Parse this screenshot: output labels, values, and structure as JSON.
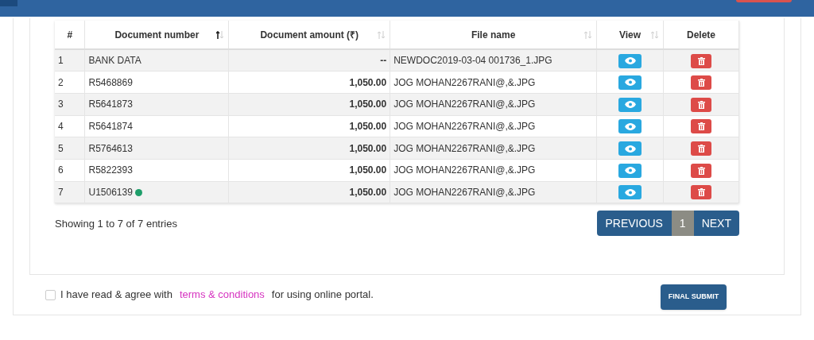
{
  "table": {
    "columns": [
      {
        "label": "#",
        "sortable": false
      },
      {
        "label": "Document number",
        "sortable": true,
        "sorted": true
      },
      {
        "label": "Document amount (₹)",
        "sortable": true,
        "sorted": false
      },
      {
        "label": "File name",
        "sortable": true,
        "sorted": false
      },
      {
        "label": "View",
        "sortable": true,
        "sorted": false
      },
      {
        "label": "Delete",
        "sortable": false
      }
    ],
    "rows": [
      {
        "index": "1",
        "document_number": "BANK DATA",
        "flagged": false,
        "amount": "--",
        "file_name": "NEWDOC2019-03-04 001736_1.JPG"
      },
      {
        "index": "2",
        "document_number": "R5468869",
        "flagged": false,
        "amount": "1,050.00",
        "file_name": "JOG MOHAN2267RANI@,&.JPG"
      },
      {
        "index": "3",
        "document_number": "R5641873",
        "flagged": false,
        "amount": "1,050.00",
        "file_name": "JOG MOHAN2267RANI@,&.JPG"
      },
      {
        "index": "4",
        "document_number": "R5641874",
        "flagged": false,
        "amount": "1,050.00",
        "file_name": "JOG MOHAN2267RANI@,&.JPG"
      },
      {
        "index": "5",
        "document_number": "R5764613",
        "flagged": false,
        "amount": "1,050.00",
        "file_name": "JOG MOHAN2267RANI@,&.JPG"
      },
      {
        "index": "6",
        "document_number": "R5822393",
        "flagged": false,
        "amount": "1,050.00",
        "file_name": "JOG MOHAN2267RANI@,&.JPG"
      },
      {
        "index": "7",
        "document_number": "U1506139",
        "flagged": true,
        "amount": "1,050.00",
        "file_name": "JOG MOHAN2267RANI@,&.JPG"
      }
    ]
  },
  "info": "Showing 1 to 7 of 7 entries",
  "pagination": {
    "previous": "PREVIOUS",
    "pages": [
      {
        "label": "1",
        "selected": true
      }
    ],
    "next": "NEXT"
  },
  "agreement": {
    "checked": false,
    "before": "I have read & agree with",
    "link": "terms & conditions",
    "after": "for using online portal."
  },
  "submit": "FINAL SUBMIT"
}
